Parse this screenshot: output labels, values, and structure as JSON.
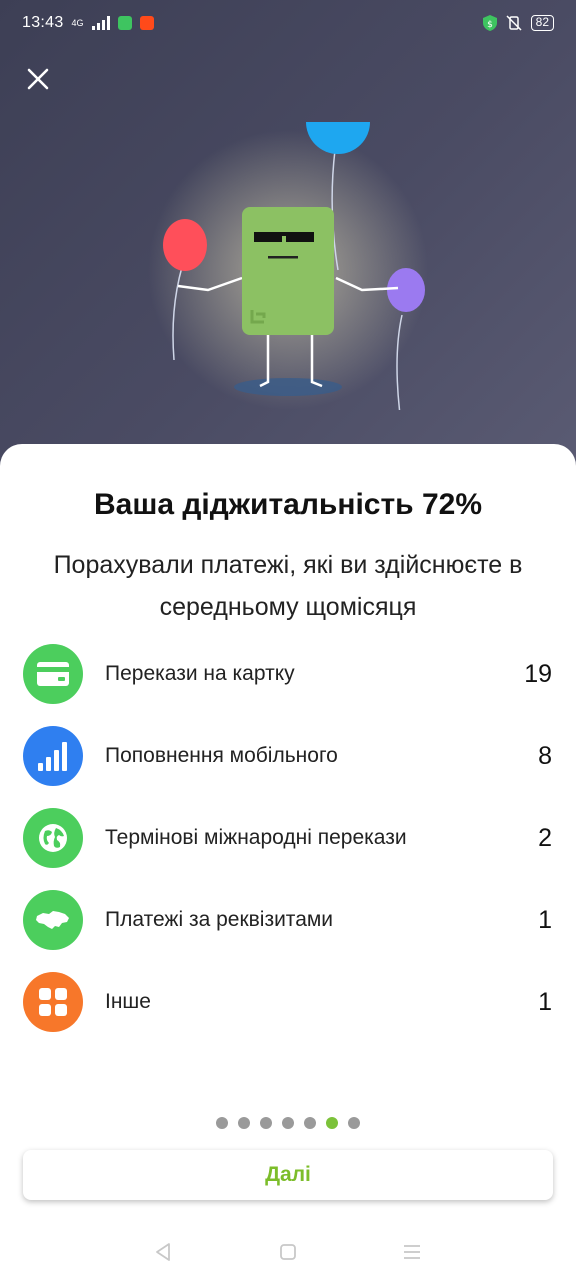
{
  "status_bar": {
    "time": "13:43",
    "network": "4G",
    "battery": "82"
  },
  "header": {
    "close_icon": "close-icon"
  },
  "main": {
    "title": "Ваша діджитальність 72%",
    "subtitle": "Порахували платежі, які ви здійснюєте в середньому щомісяця",
    "items": [
      {
        "label": "Перекази на картку",
        "count": "19",
        "icon": "card-icon",
        "color": "#4cce5d"
      },
      {
        "label": "Поповнення мобільного",
        "count": "8",
        "icon": "signal-bars-icon",
        "color": "#2f7ff0"
      },
      {
        "label": "Термінові міжнародні перекази",
        "count": "2",
        "icon": "globe-icon",
        "color": "#4cce5d"
      },
      {
        "label": "Платежі за реквізитами",
        "count": "1",
        "icon": "ukraine-map-icon",
        "color": "#4cce5d"
      },
      {
        "label": "Інше",
        "count": "1",
        "icon": "grid-icon",
        "color": "#f7772a"
      }
    ]
  },
  "pagination": {
    "total": 7,
    "active_index": 5
  },
  "footer": {
    "next_label": "Далі"
  },
  "colors": {
    "accent": "#7cbd2a",
    "hero_bg": "#44465c"
  }
}
